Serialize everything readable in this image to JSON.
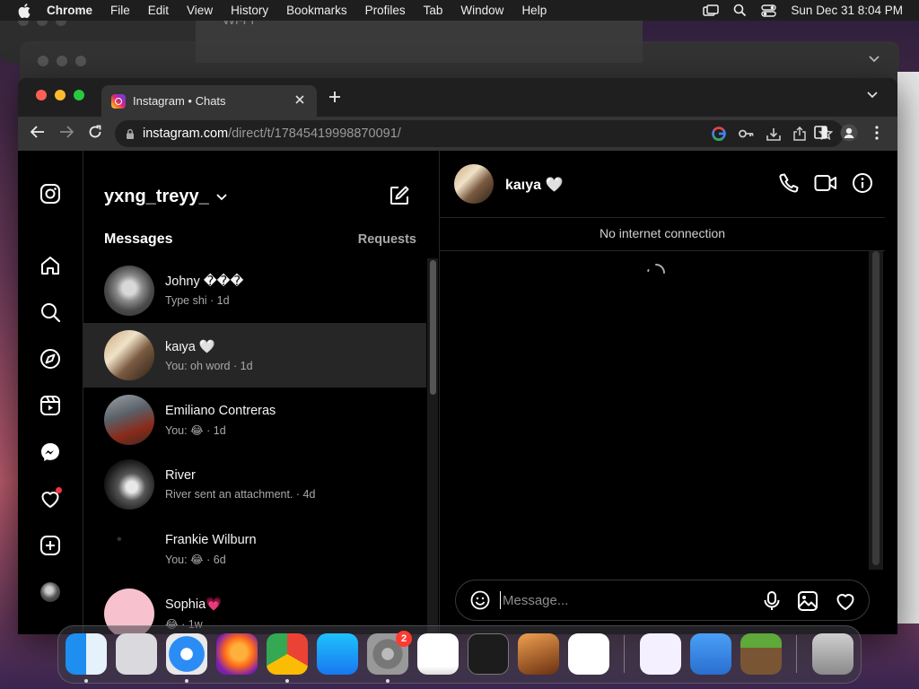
{
  "menubar": {
    "app": "Chrome",
    "items": [
      "File",
      "Edit",
      "View",
      "History",
      "Bookmarks",
      "Profiles",
      "Tab",
      "Window",
      "Help"
    ],
    "clock": "Sun Dec 31  8:04 PM"
  },
  "background_window": {
    "wifi_title": "Wi-Fi"
  },
  "browser": {
    "tab_title": "Instagram • Chats",
    "url_host": "instagram.com",
    "url_path": "/direct/t/17845419998870091/"
  },
  "inbox": {
    "username": "yxng_treyy_",
    "messages_heading": "Messages",
    "requests_label": "Requests",
    "conversations": [
      {
        "name": "Johny ���",
        "preview": "Type shi · 1d"
      },
      {
        "name": "kaιya 🤍",
        "preview": "You: oh word · 1d"
      },
      {
        "name": "Emiliano Contreras",
        "preview": "You: 😂 · 1d"
      },
      {
        "name": "River",
        "preview": "River sent an attachment. · 4d"
      },
      {
        "name": "Frankie Wilburn",
        "preview": "You: 😂 · 6d"
      },
      {
        "name": "Sophia💗",
        "preview": "😂 · 1w"
      }
    ]
  },
  "chat": {
    "contact_name": "kaιya 🤍",
    "status": "No internet connection",
    "message_placeholder": "Message..."
  },
  "dock": {
    "settings_badge": "2"
  },
  "colors": {
    "notification_dot": "#ff3040",
    "accent_red": "#ff5f57",
    "accent_yellow": "#febc2e",
    "accent_green": "#28c840"
  }
}
